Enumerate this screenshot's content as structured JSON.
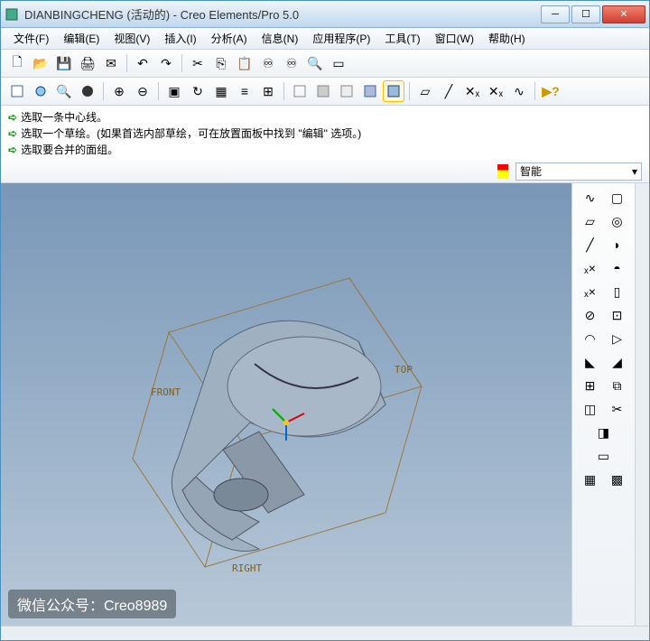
{
  "window": {
    "title": "DIANBINGCHENG (活动的) - Creo Elements/Pro 5.0"
  },
  "menu": [
    "文件(F)",
    "编辑(E)",
    "视图(V)",
    "插入(I)",
    "分析(A)",
    "信息(N)",
    "应用程序(P)",
    "工具(T)",
    "窗口(W)",
    "帮助(H)"
  ],
  "messages": [
    "选取一条中心线。",
    "选取一个草绘。(如果首选内部草绘，可在放置面板中找到 \"编辑\" 选项。)",
    "选取要合并的面组。"
  ],
  "filter": {
    "selected": "智能"
  },
  "labels": {
    "front": "FRONT",
    "top": "TOP",
    "right": "RIGHT"
  },
  "watermark": "微信公众号：Creo8989",
  "icons": {
    "new": "🗋",
    "open": "📂",
    "save": "💾",
    "print": "🖨",
    "mail": "✉",
    "undo": "↶",
    "redo": "↷",
    "cut": "✂",
    "copy": "⎘",
    "paste": "📋",
    "regen": "♾",
    "find": "🔍",
    "zoom_in": "⊕",
    "zoom_out": "⊖",
    "refit": "▣",
    "plane": "▱",
    "axis": "╱",
    "point": "·",
    "csys": "✕",
    "help": "❓"
  }
}
